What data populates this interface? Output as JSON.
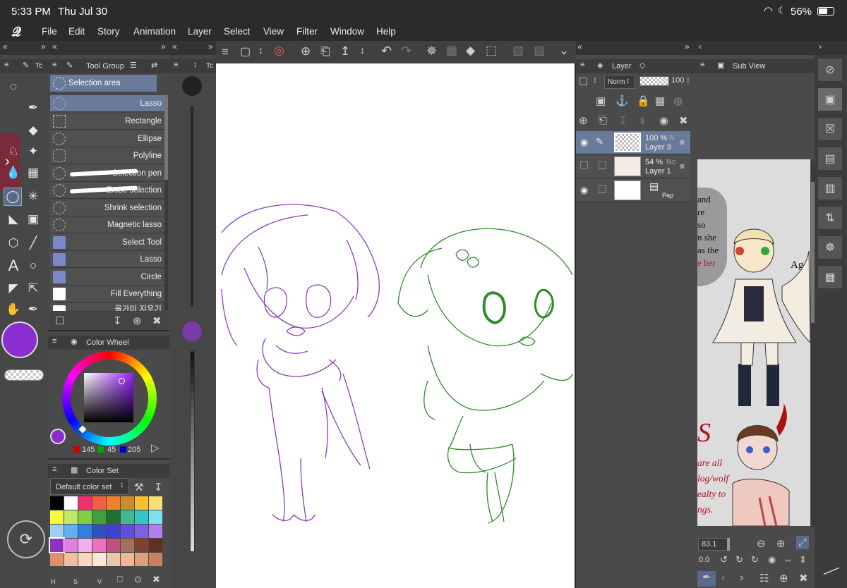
{
  "status": {
    "time": "5:33 PM",
    "date": "Thu Jul 30",
    "battery": "56%"
  },
  "menu": [
    "File",
    "Edit",
    "Story",
    "Animation",
    "Layer",
    "Select",
    "View",
    "Filter",
    "Window",
    "Help"
  ],
  "tool_panel": {
    "tab_short": "Tc"
  },
  "tool_group": {
    "title": "Tool Group",
    "header": "Selection area",
    "items": [
      "Lasso",
      "Rectangle",
      "Ellipse",
      "Polyline",
      "Selection pen",
      "Erase selection",
      "Shrink selection",
      "Magnetic lasso",
      "Select Tool",
      "Lasso",
      "Circle",
      "Fill Everything",
      "올가미 지우기"
    ]
  },
  "brush_size_tab": "Tc",
  "color_wheel": {
    "title": "Color Wheel",
    "r": "145",
    "g": "45",
    "b": "205",
    "main_color": "#912dcd"
  },
  "color_set": {
    "title": "Color Set",
    "selected": "Default color set",
    "bottom_labels": [
      "H",
      "S",
      "V"
    ],
    "swatches": [
      "#000000",
      "#ffffff",
      "#f0306a",
      "#f06040",
      "#f08030",
      "#c8902c",
      "#f8c030",
      "#f8e070",
      "#f8f840",
      "#c0e860",
      "#80d040",
      "#40a040",
      "#207030",
      "#40b890",
      "#30c8c8",
      "#80e0f0",
      "#a0d0f0",
      "#60b0f0",
      "#3080e0",
      "#3050c0",
      "#4040d0",
      "#6050e0",
      "#8060e0",
      "#b080f0",
      "#9030c0",
      "#e080e0",
      "#f0b0f0",
      "#f070c0",
      "#c05080",
      "#a07060",
      "#804030",
      "#603020",
      "#e09070",
      "#f0c0a0",
      "#f8d8c0",
      "#f8e8d8",
      "#e8c8a8",
      "#f0b898",
      "#d8a080",
      "#c88060"
    ]
  },
  "layer_panel": {
    "title": "Layer",
    "blend": "Norm",
    "opacity": "100",
    "layers": [
      {
        "opacity": "100 %",
        "mode": "N",
        "name": "Layer 3"
      },
      {
        "opacity": "54 %",
        "mode": "Nc",
        "name": "Layer 1"
      },
      {
        "opacity": "",
        "mode": "",
        "name": "Pap"
      }
    ]
  },
  "sub_view": {
    "title": "Sub View",
    "zoom": "83.1",
    "rotation": "0.0",
    "text_lines": [
      "and",
      "re",
      "so",
      "n she",
      "as the",
      "e her",
      "Age"
    ],
    "caption_lines": [
      "are all",
      "log/wolf",
      "ealty to",
      "ngs."
    ],
    "caption_letter": "S"
  },
  "canvas": {
    "background": "#ffffff",
    "stroke_purple": "#8e3dbd",
    "stroke_green": "#2f8a2a"
  }
}
